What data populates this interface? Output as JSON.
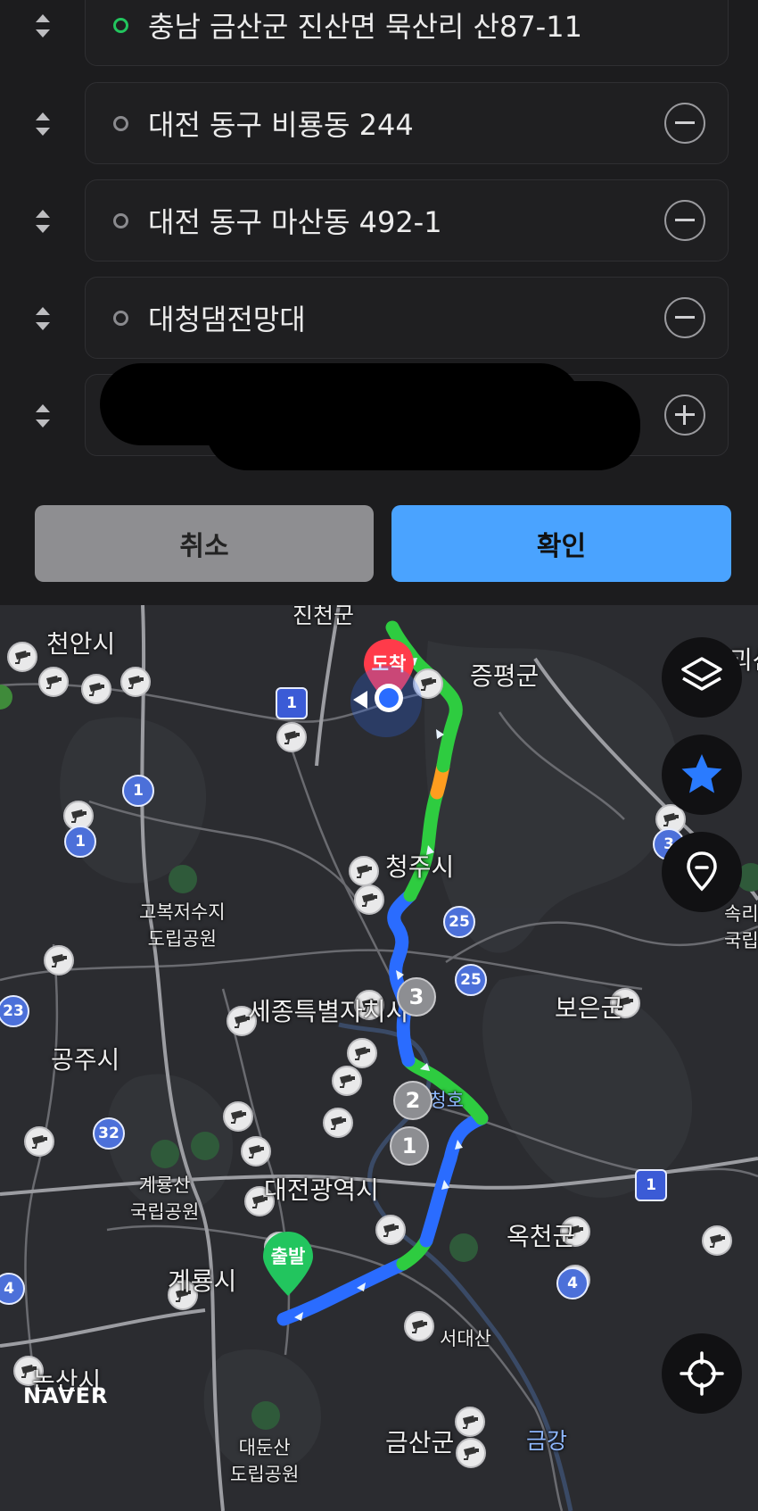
{
  "waypoints": [
    {
      "text": "충남 금산군 진산면 묵산리 산87-11",
      "dot": "start",
      "action": "none"
    },
    {
      "text": "대전 동구 비룡동 244",
      "dot": "via",
      "action": "remove"
    },
    {
      "text": "대전 동구 마산동 492-1",
      "dot": "via",
      "action": "remove"
    },
    {
      "text": "대청댐전망대",
      "dot": "via",
      "action": "remove"
    },
    {
      "text": "",
      "dot": "none",
      "action": "add"
    }
  ],
  "buttons": {
    "cancel": "취소",
    "confirm": "확인"
  },
  "map": {
    "places": {
      "jincheon": "진천군",
      "cheonan": "천안시",
      "jeungpyeong": "증평군",
      "goesan": "괴산군",
      "cheongju": "청주시",
      "gobok": "고복저수지\n도립공원",
      "sejong": "세종특별자치시",
      "boeun": "보은군",
      "gongju": "공주시",
      "daecheongho": "대청호",
      "gyeryongsan": "계룡산\n국립공원",
      "daejeon": "대전광역시",
      "okcheon": "옥천군",
      "gyeryongsi": "계룡시",
      "seodaesan": "서대산",
      "nonsan": "논산시",
      "daedunsan": "대둔산\n도립공원",
      "geumsan": "금산군",
      "geumgang": "금강",
      "songni": "속리\n국립"
    },
    "markers": {
      "start": "출발",
      "end": "도착"
    },
    "waypoint_numbers": [
      "1",
      "2",
      "3"
    ],
    "road_numbers": [
      "1",
      "1",
      "1",
      "25",
      "25",
      "23",
      "32",
      "4",
      "4",
      "1",
      "3"
    ],
    "brand": "NAVER",
    "controls": [
      "layers-icon",
      "star-icon",
      "place-pin-icon",
      "current-location-icon"
    ],
    "colors": {
      "route_green": "#2ecc40",
      "route_blue": "#2a6cff",
      "route_orange": "#ff9d1f",
      "start": "#22c55e",
      "end": "#ff3b4a",
      "accent": "#4aa3ff"
    }
  }
}
